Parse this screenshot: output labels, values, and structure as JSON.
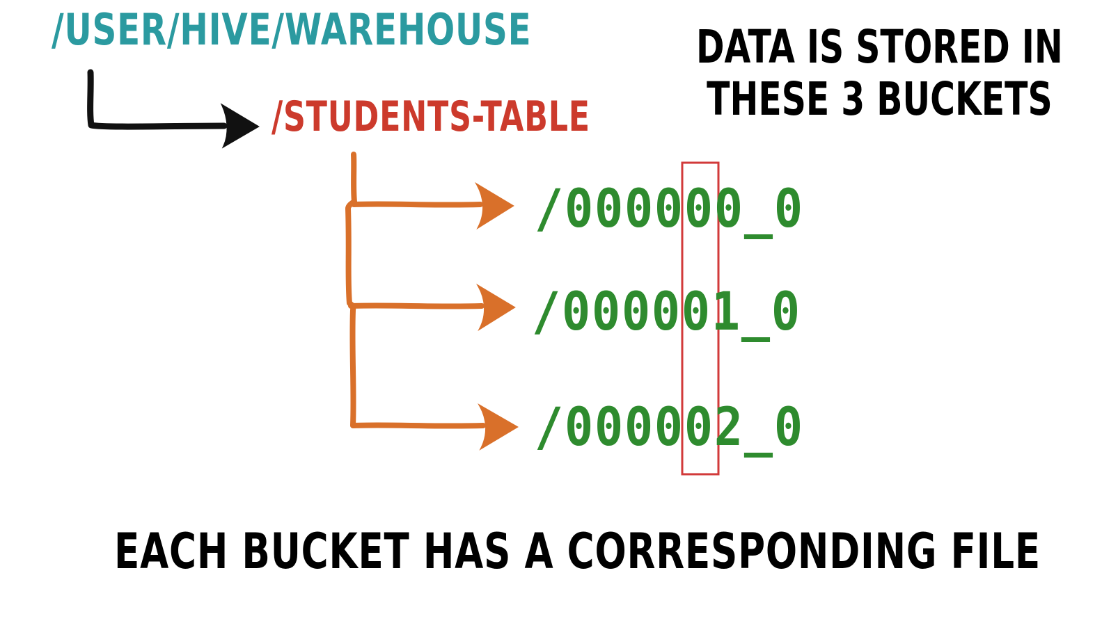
{
  "paths": {
    "warehouse": "/USER/HIVE/WAREHOUSE",
    "table": "/STUDENTS-TABLE"
  },
  "note": {
    "line1": "DATA IS STORED IN",
    "line2": "THESE 3 BUCKETS"
  },
  "bucket_files": [
    "/000000_0",
    "/000001_0",
    "/000002_0"
  ],
  "caption": "EACH BUCKET HAS A CORRESPONDING FILE",
  "colors": {
    "warehouse": "#2b9aa0",
    "table": "#cc3a2c",
    "files": "#2e8b2e",
    "bucket_arrows": "#d9702a",
    "root_arrow": "#111111",
    "highlight_box": "#d23a3a",
    "text": "#000000"
  }
}
